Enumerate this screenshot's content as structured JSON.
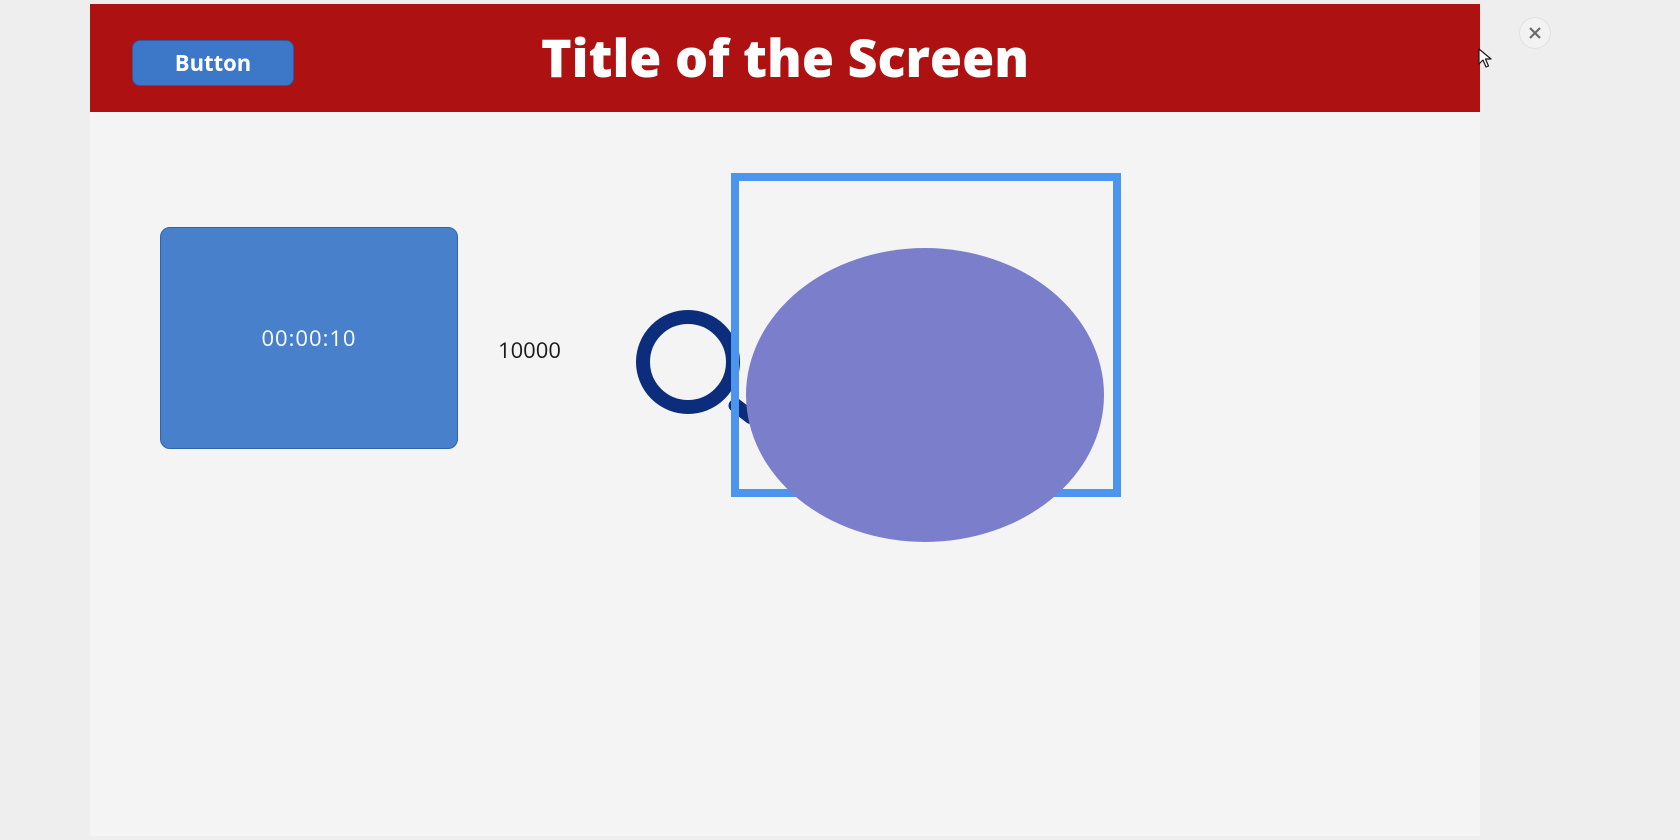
{
  "header": {
    "button_label": "Button",
    "title": "Title of the Screen"
  },
  "timer": {
    "value": "00:00:10"
  },
  "number": {
    "value": "10000"
  },
  "colors": {
    "header_bg": "#ae1111",
    "button_bg": "#3d77c7",
    "timer_bg": "#4880cc",
    "frame_border": "#4c95ef",
    "ring": "#0c2d7b",
    "ellipse": "#7b7ecb"
  },
  "icons": {
    "close": "close-icon",
    "search": "search-icon"
  }
}
